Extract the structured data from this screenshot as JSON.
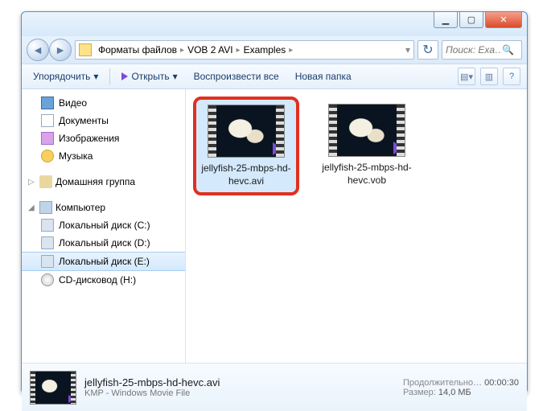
{
  "window_controls": {
    "min": "▁",
    "max": "▢",
    "close": "✕"
  },
  "nav": {
    "back": "◄",
    "forward": "►"
  },
  "breadcrumb": {
    "seg1": "Форматы файлов",
    "seg2": "VOB 2 AVI",
    "seg3": "Examples"
  },
  "refresh_glyph": "↻",
  "search": {
    "placeholder": "Поиск: Exa…",
    "icon": "🔍"
  },
  "toolbar": {
    "organize": "Упорядочить",
    "open": "Открыть",
    "play_all": "Воспроизвести все",
    "new_folder": "Новая папка",
    "dd": "▾"
  },
  "sidebar": {
    "videos": "Видео",
    "documents": "Документы",
    "images": "Изображения",
    "music": "Музыка",
    "homegroup": "Домашняя группа",
    "computer": "Компьютер",
    "disk_c": "Локальный диск (C:)",
    "disk_d": "Локальный диск (D:)",
    "disk_e": "Локальный диск (E:)",
    "cd_h": "CD-дисковод (H:)"
  },
  "files": [
    {
      "name": "jellyfish-25-mbps-hd-hevc.avi",
      "selected": true,
      "highlighted": true
    },
    {
      "name": "jellyfish-25-mbps-hd-hevc.vob",
      "selected": false,
      "highlighted": false
    }
  ],
  "details": {
    "name": "jellyfish-25-mbps-hd-hevc.avi",
    "type": "KMP - Windows Movie File",
    "dur_label": "Продолжительно…",
    "duration": "00:00:30",
    "size_label": "Размер:",
    "size": "14,0 МБ"
  }
}
